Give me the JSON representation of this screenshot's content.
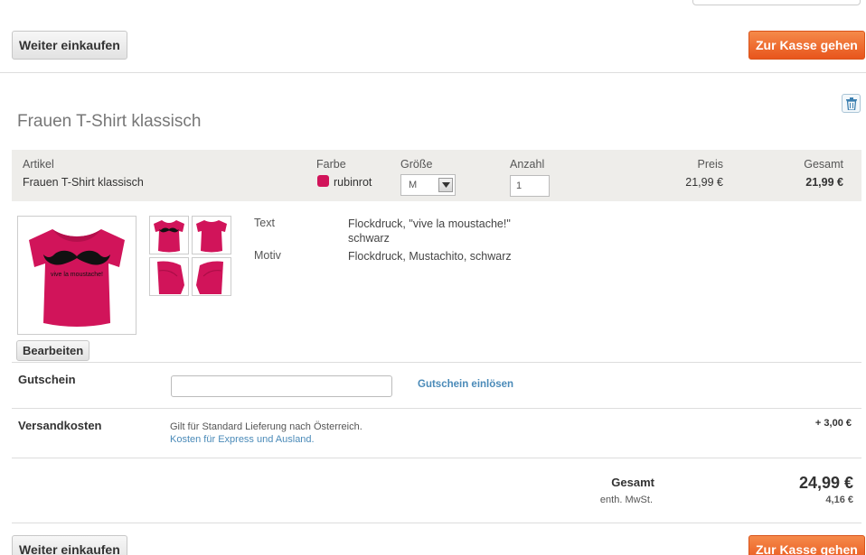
{
  "nav": {
    "continue_label": "Weiter einkaufen",
    "checkout_label": "Zur Kasse gehen"
  },
  "product": {
    "title": "Frauen T-Shirt klassisch",
    "header": {
      "article_label": "Artikel",
      "article_value": "Frauen T-Shirt klassisch",
      "color_label": "Farbe",
      "color_value": "rubinrot",
      "color_hex": "#d1145a",
      "size_label": "Größe",
      "size_value": "M",
      "qty_label": "Anzahl",
      "qty_value": "1",
      "price_label": "Preis",
      "price_value": "21,99 €",
      "total_label": "Gesamt",
      "total_value": "21,99 €"
    },
    "shirt_print_text": "vive la moustache!",
    "details": [
      {
        "label": "Text",
        "value_line1": "Flockdruck, \"vive la moustache!\"",
        "value_line2": "schwarz"
      },
      {
        "label": "Motiv",
        "value_line1": "Flockdruck, Mustachito, schwarz",
        "value_line2": ""
      }
    ],
    "edit_label": "Bearbeiten"
  },
  "coupon": {
    "label": "Gutschein",
    "input_value": "",
    "redeem_label": "Gutschein einlösen"
  },
  "shipping": {
    "label": "Versandkosten",
    "note": "Gilt für Standard Lieferung nach Österreich.",
    "link": "Kosten für Express und Ausland.",
    "amount": "+ 3,00 €"
  },
  "summary": {
    "total_label": "Gesamt",
    "total_value": "24,99 €",
    "vat_label": "enth. MwSt.",
    "vat_value": "4,16 €"
  },
  "colors": {
    "accent_orange": "#e8551c",
    "shirt_pink": "#d1145a",
    "link_blue": "#4a8ab8"
  }
}
